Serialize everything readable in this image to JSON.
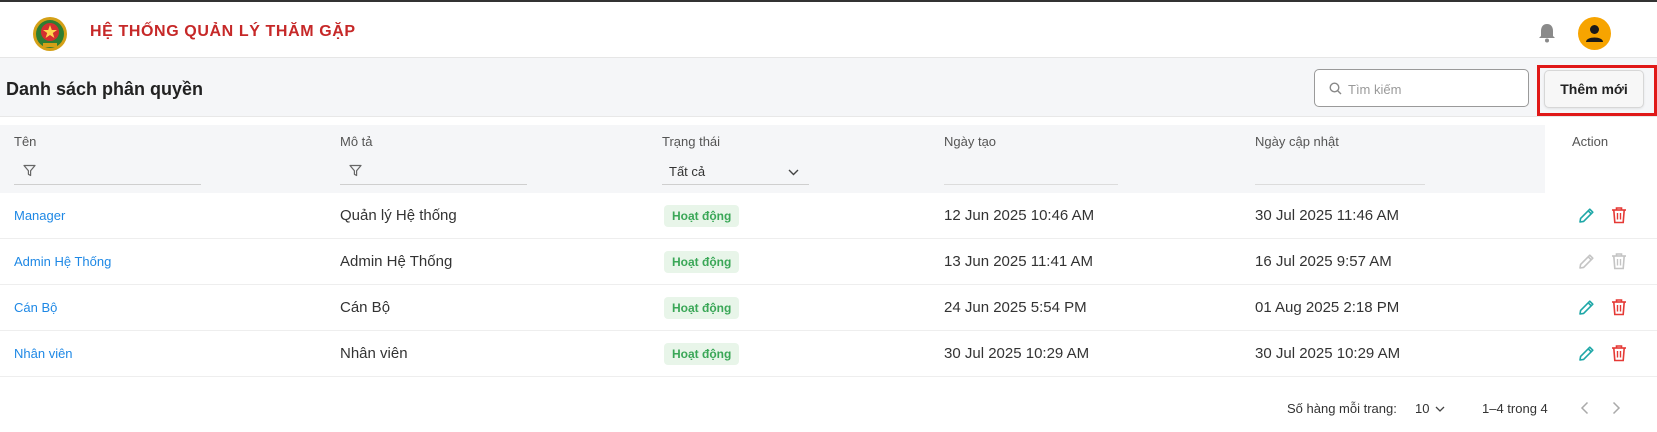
{
  "header": {
    "title": "HỆ THỐNG QUẢN LÝ THĂM GẶP",
    "icons": {
      "logo": "police-emblem-icon",
      "notifications": "bell-icon",
      "user": "user-avatar-icon"
    },
    "colors": {
      "title": "#c62828",
      "avatar": "#f7a400"
    }
  },
  "toolbar": {
    "title": "Danh sách phân quyền",
    "search_placeholder": "Tìm kiếm",
    "add_label": "Thêm mới"
  },
  "table": {
    "columns": {
      "name": "Tên",
      "description": "Mô tả",
      "status": "Trạng thái",
      "created": "Ngày tạo",
      "updated": "Ngày cập nhật",
      "action": "Action"
    },
    "status_filter_value": "Tất cả",
    "rows": [
      {
        "name": "Manager",
        "description": "Quản lý Hệ thống",
        "status": "Hoạt động",
        "created": "12 Jun 2025 10:46 AM",
        "updated": "30 Jul 2025 11:46 AM",
        "actions_enabled": true
      },
      {
        "name": "Admin Hệ Thống",
        "description": "Admin Hệ Thống",
        "status": "Hoạt động",
        "created": "13 Jun 2025 11:41 AM",
        "updated": "16 Jul 2025 9:57 AM",
        "actions_enabled": false
      },
      {
        "name": "Cán Bộ",
        "description": "Cán Bộ",
        "status": "Hoạt động",
        "created": "24 Jun 2025 5:54 PM",
        "updated": "01 Aug 2025 2:18 PM",
        "actions_enabled": true
      },
      {
        "name": "Nhân viên",
        "description": "Nhân viên",
        "status": "Hoạt động",
        "created": "30 Jul 2025 10:29 AM",
        "updated": "30 Jul 2025 10:29 AM",
        "actions_enabled": true
      }
    ],
    "colors": {
      "link": "#1e88e5",
      "badge_text": "#3aa757",
      "badge_bg": "#e8f5e9",
      "edit": "#1ea7a7",
      "delete": "#e53935",
      "disabled": "#c4c4c4"
    }
  },
  "pagination": {
    "rows_per_page_label": "Số hàng mỗi trang:",
    "rows_per_page": "10",
    "range": "1–4 trong 4"
  }
}
